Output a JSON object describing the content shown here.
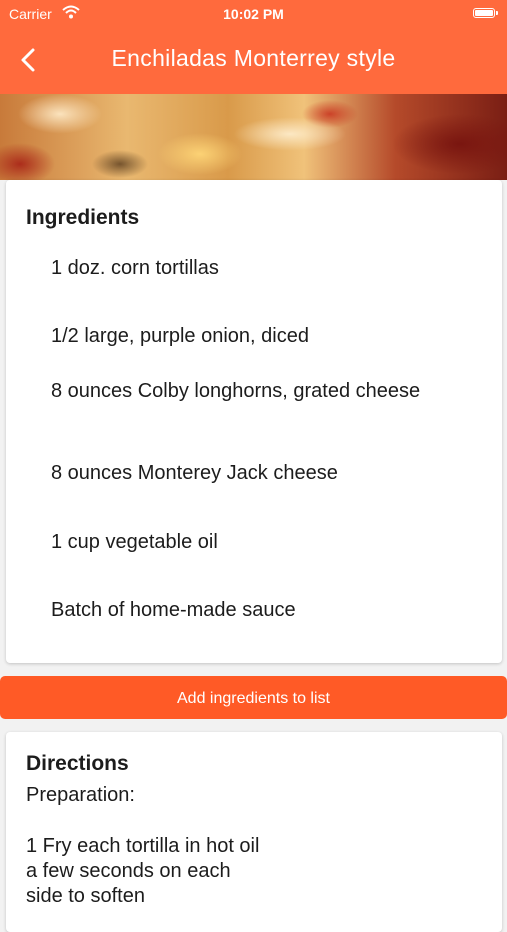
{
  "status_bar": {
    "carrier": "Carrier",
    "time": "10:02 PM"
  },
  "header": {
    "title": "Enchiladas Monterrey style"
  },
  "ingredients": {
    "heading": "Ingredients",
    "items": [
      "1 doz. corn tortillas",
      "1/2 large, purple onion, diced",
      "8 ounces Colby longhorns, grated cheese",
      "8 ounces Monterey Jack cheese",
      "1 cup vegetable oil",
      "Batch of home-made sauce"
    ]
  },
  "add_button": {
    "label": "Add ingredients to list"
  },
  "directions": {
    "heading": "Directions",
    "subheading": "Preparation:",
    "body": "1 Fry each tortilla in hot oil a few seconds on each side to soften"
  },
  "theme": {
    "accent": "#ff6a3d",
    "button": "#ff5a26"
  }
}
